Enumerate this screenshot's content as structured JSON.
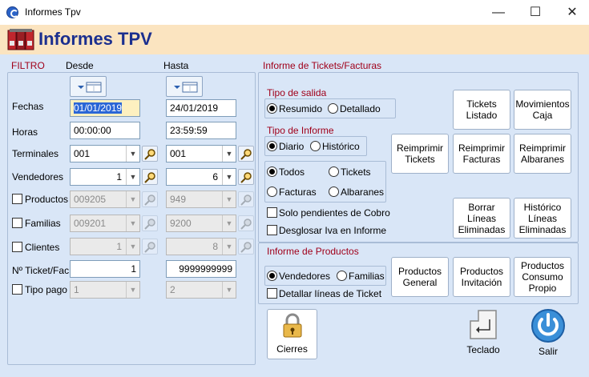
{
  "window": {
    "title": "Informes Tpv",
    "minimize": "—",
    "maximize": "☐",
    "close": "✕"
  },
  "header": {
    "title": "Informes TPV"
  },
  "filter": {
    "section_label": "FILTRO",
    "col_desde": "Desde",
    "col_hasta": "Hasta",
    "rows": {
      "fechas": {
        "label": "Fechas",
        "desde": "01/01/2019",
        "hasta": "24/01/2019"
      },
      "horas": {
        "label": "Horas",
        "desde": "00:00:00",
        "hasta": "23:59:59"
      },
      "terminales": {
        "label": "Terminales",
        "desde": "001",
        "hasta": "001"
      },
      "vendedores": {
        "label": "Vendedores",
        "desde": "1",
        "hasta": "6"
      },
      "productos": {
        "label": "Productos",
        "desde": "009205",
        "hasta": "949"
      },
      "familias": {
        "label": "Familias",
        "desde": "009201",
        "hasta": "9200"
      },
      "clientes": {
        "label": "Clientes",
        "desde": "1",
        "hasta": "8"
      },
      "ticket": {
        "label": "Nº Ticket/Fac",
        "desde": "1",
        "hasta": "9999999999"
      },
      "tipopago": {
        "label": "Tipo pago",
        "desde": "1",
        "hasta": "2"
      }
    }
  },
  "tickets": {
    "section_label": "Informe de Tickets/Facturas",
    "tipo_salida": {
      "label": "Tipo de salida",
      "resumido": "Resumido",
      "detallado": "Detallado"
    },
    "tipo_informe": {
      "label": "Tipo de Informe",
      "diario": "Diario",
      "historico": "Histórico"
    },
    "doc": {
      "todos": "Todos",
      "tickets": "Tickets",
      "facturas": "Facturas",
      "albaranes": "Albaranes"
    },
    "solo_pendientes": "Solo pendientes de Cobro",
    "desglosar_iva": "Desglosar Iva en Informe",
    "buttons": {
      "tickets_listado": "Tickets\nListado",
      "movimientos_caja": "Movimientos\nCaja",
      "reimprimir_tickets": "Reimprimir\nTickets",
      "reimprimir_facturas": "Reimprimir\nFacturas",
      "reimprimir_albaranes": "Reimprimir\nAlbaranes",
      "borrar_lineas": "Borrar\nLíneas\nEliminadas",
      "historico_lineas": "Histórico\nLíneas\nEliminadas"
    }
  },
  "productos": {
    "section_label": "Informe de Productos",
    "vendedores": "Vendedores",
    "familias": "Familias",
    "detallar": "Detallar líneas de Ticket",
    "buttons": {
      "general": "Productos\nGeneral",
      "invitacion": "Productos\nInvitación",
      "consumo": "Productos\nConsumo\nPropio"
    }
  },
  "bottom": {
    "cierres": "Cierres",
    "teclado": "Teclado",
    "salir": "Salir"
  },
  "colors": {
    "accent_red": "#a0001a",
    "title_blue": "#1b2f8f",
    "panel": "#d9e6f7",
    "header": "#fbe4c0"
  }
}
